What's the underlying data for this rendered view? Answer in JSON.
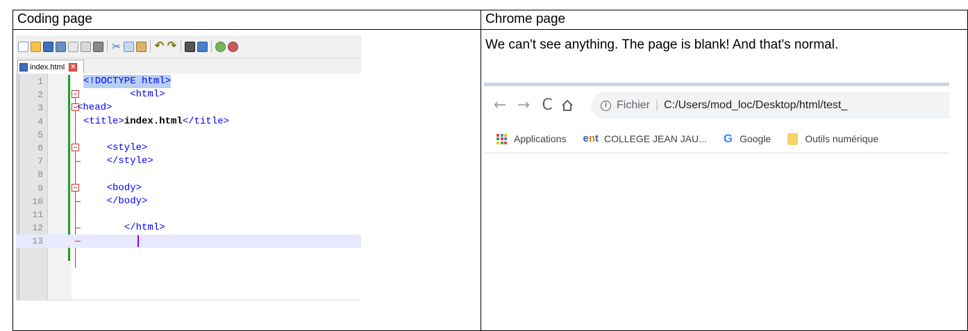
{
  "table": {
    "header_left": "Coding page",
    "header_right": "Chrome page"
  },
  "notepad": {
    "toolbar_icons": [
      "new-file-icon",
      "open-file-icon",
      "save-icon",
      "save-all-icon",
      "close-icon",
      "close-all-icon",
      "print-icon",
      "cut-icon",
      "copy-icon",
      "paste-icon",
      "undo-icon",
      "redo-icon",
      "find-icon",
      "replace-icon",
      "zoom-in-icon",
      "zoom-out-icon"
    ],
    "tab_label": "index.html",
    "lines": [
      {
        "num": "1",
        "text": "<!DOCTYPE html>"
      },
      {
        "num": "2",
        "text": "        <html>"
      },
      {
        "num": "3",
        "text": "<head>"
      },
      {
        "num": "4",
        "text_pre": "<title>",
        "text_bold": "index.html",
        "text_post": "</title>"
      },
      {
        "num": "5",
        "text": ""
      },
      {
        "num": "6",
        "text": "    <style>"
      },
      {
        "num": "7",
        "text": "    </style>"
      },
      {
        "num": "8",
        "text": ""
      },
      {
        "num": "9",
        "text": "    <body>"
      },
      {
        "num": "10",
        "text": "    </body>"
      },
      {
        "num": "11",
        "text": ""
      },
      {
        "num": "12",
        "text": "       </html>"
      },
      {
        "num": "13",
        "text": ""
      }
    ],
    "colors": {
      "change_bar": "#1f9e2c",
      "fold_marker": "#c83232",
      "tag": "#0000ff"
    }
  },
  "chrome": {
    "caption": "We can't see anything. The page is blank! And that's normal.",
    "omnibox_scheme": "Fichier",
    "omnibox_url": "C:/Users/mod_loc/Desktop/html/test_",
    "bookmarks": {
      "apps": "Applications",
      "college": "COLLEGE JEAN JAU...",
      "google": "Google",
      "outils": "Outils numérique"
    }
  }
}
